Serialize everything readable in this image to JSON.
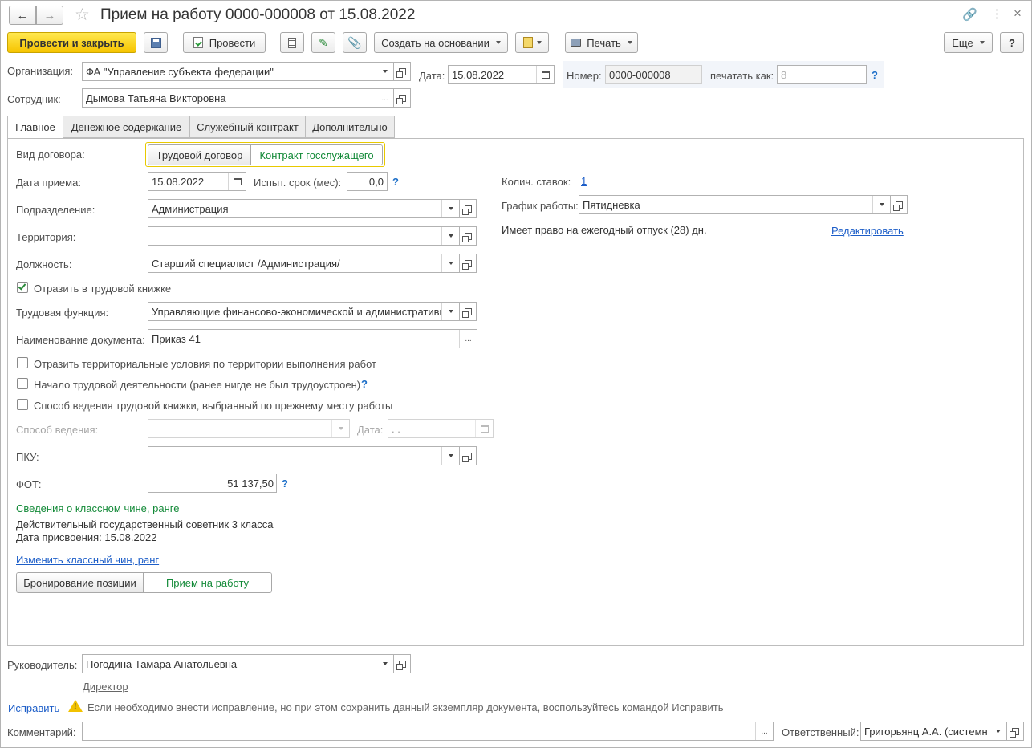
{
  "window": {
    "title": "Прием на работу 0000-000008 от 15.08.2022"
  },
  "toolbar": {
    "post_close": "Провести и закрыть",
    "post": "Провести",
    "create_based": "Создать на основании",
    "print": "Печать",
    "more": "Еще",
    "help": "?"
  },
  "header": {
    "org_label": "Организация:",
    "org_value": "ФА \"Управление субъекта федерации\"",
    "date_label": "Дата:",
    "date_value": "15.08.2022",
    "number_label": "Номер:",
    "number_value": "0000-000008",
    "print_as_label": "печатать как:",
    "print_as_placeholder": "8",
    "employee_label": "Сотрудник:",
    "employee_value": "Дымова Татьяна Викторовна"
  },
  "tabs": [
    {
      "label": "Главное"
    },
    {
      "label": "Денежное содержание"
    },
    {
      "label": "Служебный контракт"
    },
    {
      "label": "Дополнительно"
    }
  ],
  "main": {
    "contract_type_label": "Вид договора:",
    "contract_opt1": "Трудовой договор",
    "contract_opt2": "Контракт госслужащего",
    "hire_date_label": "Дата приема:",
    "hire_date_value": "15.08.2022",
    "probation_label": "Испыт. срок (мес):",
    "probation_value": "0,0",
    "department_label": "Подразделение:",
    "department_value": "Администрация",
    "territory_label": "Территория:",
    "territory_value": "",
    "position_label": "Должность:",
    "position_value": "Старший специалист /Администрация/",
    "workbook_check": "Отразить в трудовой книжке",
    "labor_function_label": "Трудовая функция:",
    "labor_function_value": "Управляющие финансово-экономической и административн",
    "doc_name_label": "Наименование документа:",
    "doc_name_value": "Приказ 41",
    "check_territorial": "Отразить территориальные условия по территории выполнения работ",
    "check_start": "Начало трудовой деятельности (ранее нигде не был трудоустроен)",
    "check_method": "Способ ведения трудовой книжки, выбранный по прежнему месту работы",
    "method_label": "Способ ведения:",
    "method_date_label": "Дата:",
    "method_date_value": " .  .",
    "pku_label": "ПКУ:",
    "fot_label": "ФОТ:",
    "fot_value": "51 137,50",
    "rank_header": "Сведения о классном чине, ранге",
    "rank_text": "Действительный государственный советник 3 класса",
    "rank_date": "Дата присвоения:  15.08.2022",
    "rank_change_link": "Изменить классный чин, ранг",
    "bottom_opt1": "Бронирование позиции",
    "bottom_opt2": "Прием на работу",
    "rates_label": "Колич. ставок:",
    "rates_value": "1",
    "schedule_label": "График работы:",
    "schedule_value": "Пятидневка",
    "vacation_text": "Имеет право на ежегодный отпуск (28) дн.",
    "edit_link": "Редактировать"
  },
  "footer": {
    "manager_label": "Руководитель:",
    "manager_value": "Погодина Тамара Анатольевна",
    "manager_position": "Директор",
    "fix_link": "Исправить",
    "warning_text": "Если необходимо внести исправление, но при этом сохранить данный экземпляр документа, воспользуйтесь командой Исправить",
    "comment_label": "Комментарий:",
    "responsible_label": "Ответственный:",
    "responsible_value": "Григорьянц А.А. (системн"
  },
  "colors": {
    "accent_yellow": "#f6c400",
    "link": "#1d5ec8",
    "green": "#138a38"
  }
}
